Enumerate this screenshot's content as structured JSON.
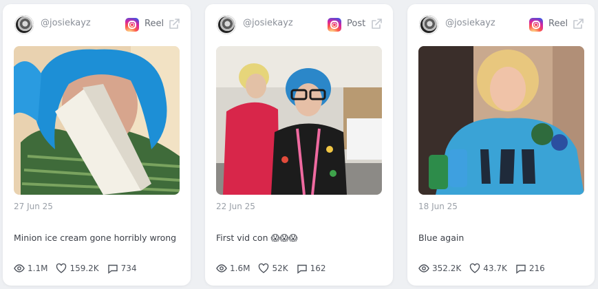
{
  "cards": [
    {
      "username": "@josiekayz",
      "platform_icon": "instagram-icon",
      "type": "Reel",
      "date": "27 Jun 25",
      "caption": "Minion ice cream gone horribly wrong",
      "views": "1.1M",
      "likes": "159.2K",
      "comments": "734"
    },
    {
      "username": "@josiekayz",
      "platform_icon": "instagram-icon",
      "type": "Post",
      "date": "22 Jun 25",
      "caption": "First vid con 😱😱😱",
      "views": "1.6M",
      "likes": "52K",
      "comments": "162"
    },
    {
      "username": "@josiekayz",
      "platform_icon": "instagram-icon",
      "type": "Reel",
      "date": "18 Jun 25",
      "caption": "Blue again",
      "views": "352.2K",
      "likes": "43.7K",
      "comments": "216"
    }
  ],
  "colors": {
    "background": "#eef0f3",
    "card": "#ffffff",
    "muted_text": "#9aa0a8",
    "body_text": "#3b3f47"
  }
}
